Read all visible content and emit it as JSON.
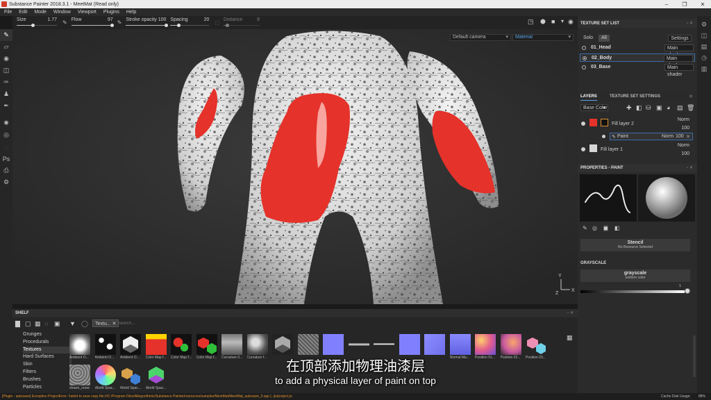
{
  "window": {
    "title": "Substance Painter 2018.3.1 - MeetMat (Read only)"
  },
  "menu": [
    "File",
    "Edit",
    "Mode",
    "Window",
    "Viewport",
    "Plugins",
    "Help"
  ],
  "toolbar": {
    "size": {
      "label": "Size",
      "value": "1.77",
      "fill": 0.4
    },
    "flow": {
      "label": "Flow",
      "value": "97",
      "fill": 0.97
    },
    "stroke_opacity": {
      "label": "Stroke opacity",
      "value": "100",
      "fill": 1.0
    },
    "spacing": {
      "label": "Spacing",
      "value": "20",
      "fill": 0.2
    },
    "distance": {
      "label": "Distance",
      "value": "8",
      "fill": 0.1
    }
  },
  "viewport": {
    "camera": "Default camera",
    "mode": "Material"
  },
  "texture_set_list": {
    "title": "TEXTURE SET LIST",
    "solo": "Solo",
    "all": "All",
    "settings": "Settings",
    "sets": [
      {
        "name": "01_Head",
        "shader": "Main shader",
        "selected": false
      },
      {
        "name": "02_Body",
        "shader": "Main shader",
        "selected": true
      },
      {
        "name": "03_Base",
        "shader": "Main shader",
        "selected": false
      }
    ]
  },
  "layers": {
    "tab_layers": "LAYERS",
    "tab_settings": "TEXTURE SET SETTINGS",
    "channel": "Base Color",
    "items": [
      {
        "name": "Fill layer 2",
        "blend": "Norm",
        "opacity": "100",
        "color": "#e5322a"
      },
      {
        "name": "Paint",
        "blend": "Norm",
        "opacity": "100"
      },
      {
        "name": "Fill layer 1",
        "blend": "Norm",
        "opacity": "100",
        "color": "#d6d6d6"
      }
    ]
  },
  "properties": {
    "title": "PROPERTIES - PAINT",
    "stencil_label": "Stencil",
    "stencil_value": "No Resource Selected",
    "grayscale_title": "GRAYSCALE",
    "grayscale_label": "grayscale",
    "grayscale_value": "uniform color",
    "slider_value": "1"
  },
  "shelf": {
    "title": "SHELF",
    "filter_tag": "Textu...",
    "search_placeholder": "Search...",
    "categories": [
      "Grunges",
      "Procedurals",
      "Textures",
      "Hard Surfaces",
      "Skin",
      "Filters",
      "Brushes",
      "Particles"
    ],
    "active_category": "Textures",
    "assets": [
      {
        "label": "Ambient O...",
        "kind": "ao"
      },
      {
        "label": "Ambient O...",
        "kind": "blot"
      },
      {
        "label": "Ambient O...",
        "kind": "hexbw"
      },
      {
        "label": "Color Map f...",
        "kind": "colormap1"
      },
      {
        "label": "Color Map f...",
        "kind": "colormap2"
      },
      {
        "label": "Color Map f...",
        "kind": "hexcolor"
      },
      {
        "label": "Curvature 0...",
        "kind": "curv1"
      },
      {
        "label": "Curvature f...",
        "kind": "curv2"
      },
      {
        "label": "",
        "kind": "hexgray"
      },
      {
        "label": "",
        "kind": "noise"
      },
      {
        "label": "",
        "kind": "normal"
      },
      {
        "label": "",
        "kind": "dash"
      },
      {
        "label": "",
        "kind": "dash2"
      },
      {
        "label": "",
        "kind": "normal"
      },
      {
        "label": "",
        "kind": "normal2"
      },
      {
        "label": "Normal Ma...",
        "kind": "normal3"
      },
      {
        "label": "Position 01...",
        "kind": "pos1"
      },
      {
        "label": "Position 02...",
        "kind": "pos2"
      },
      {
        "label": "Position 03...",
        "kind": "pos3"
      },
      {
        "label": "shawn_noise",
        "kind": "noise2"
      },
      {
        "label": "World Spac...",
        "kind": "world1"
      },
      {
        "label": "World Spac...",
        "kind": "world2"
      },
      {
        "label": "World Spac...",
        "kind": "world3"
      }
    ]
  },
  "subtitles": {
    "chinese": "在顶部添加物理油漆层",
    "english": "to add a physical layer of paint on top"
  },
  "status": {
    "error": "[Plugin - autosave] Exception ProjectError: Failed to save copy file:///C:/Program Files/Allegorithmic/Substance Painter/resources/samples/MeetMat/MeetMat_autosave_0.spp (../js/project.js:",
    "cache_label": "Cache Disk Usage:",
    "cache_value": "88%"
  },
  "colors": {
    "accent_blue": "#5aa2e6",
    "paint_red": "#e5322a",
    "error_text": "#e0912f"
  }
}
